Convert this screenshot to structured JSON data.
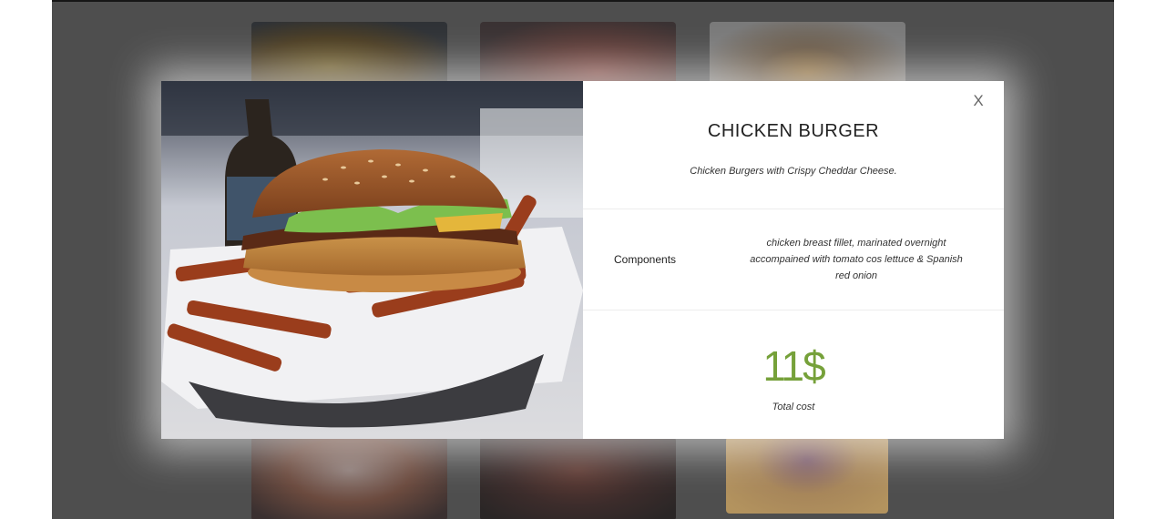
{
  "modal": {
    "close_label": "X",
    "title": "CHICKEN BURGER",
    "subtitle": "Chicken Burgers with Crispy Cheddar Cheese.",
    "components_label": "Components",
    "components_text": "chicken breast fillet, marinated overnight accompained with tomato cos lettuce & Spanish red onion",
    "price": "11$",
    "price_label": "Total cost",
    "accent_color": "#76a13a"
  },
  "background_grid": {
    "tiles": [
      "salad-photo",
      "soup-photo",
      "burger-photo",
      "cupcakes-photo",
      "meat-photo",
      "salad-bowl-photo"
    ]
  }
}
